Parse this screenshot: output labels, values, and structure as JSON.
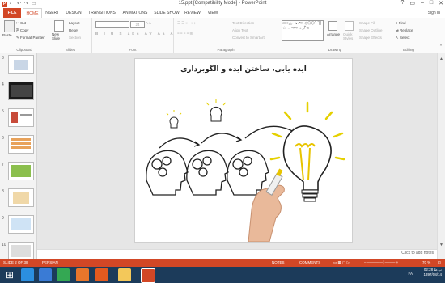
{
  "window": {
    "title": "15.ppt [Compatibility Mode] - PowerPoint",
    "help": "?",
    "sign_in": "Sign in"
  },
  "tabs": [
    "FILE",
    "HOME",
    "INSERT",
    "DESIGN",
    "TRANSITIONS",
    "ANIMATIONS",
    "SLIDE SHOW",
    "REVIEW",
    "VIEW"
  ],
  "ribbon": {
    "clipboard": {
      "paste": "Paste",
      "cut": "Cut",
      "copy": "Copy",
      "format_painter": "Format Painter",
      "label": "Clipboard"
    },
    "slides": {
      "new_slide": "New Slide",
      "layout": "Layout",
      "reset": "Reset",
      "section": "Section",
      "label": "Slides"
    },
    "font": {
      "size": "24",
      "label": "Font"
    },
    "paragraph": {
      "text_direction": "Text Direction",
      "align_text": "Align Text",
      "convert_smartart": "Convert to SmartArt",
      "label": "Paragraph"
    },
    "drawing": {
      "arrange": "Arrange",
      "quick_styles": "Quick Styles",
      "shape_fill": "Shape Fill",
      "shape_outline": "Shape Outline",
      "shape_effects": "Shape Effects",
      "label": "Drawing"
    },
    "editing": {
      "find": "Find",
      "replace": "Replace",
      "select": "Select",
      "label": "Editing"
    }
  },
  "thumbnails": [
    {
      "num": "3"
    },
    {
      "num": "4"
    },
    {
      "num": "5"
    },
    {
      "num": "6"
    },
    {
      "num": "7"
    },
    {
      "num": "8"
    },
    {
      "num": "9"
    },
    {
      "num": "10"
    }
  ],
  "slide": {
    "title": "ایده یابی، ساختن ایده و الگوبرداری"
  },
  "notes_placeholder": "Click to add notes",
  "status": {
    "slide_of": "SLIDE 2 OF 38",
    "language": "PERSIAN",
    "notes": "NOTES",
    "comments": "COMMENTS",
    "zoom": "70 %"
  },
  "tray": {
    "time": "02:28 ب.ظ",
    "date": "1397/08/14",
    "lang": "FA"
  },
  "colors": {
    "accent": "#d24726",
    "taskbar": "#1c3b5a"
  }
}
